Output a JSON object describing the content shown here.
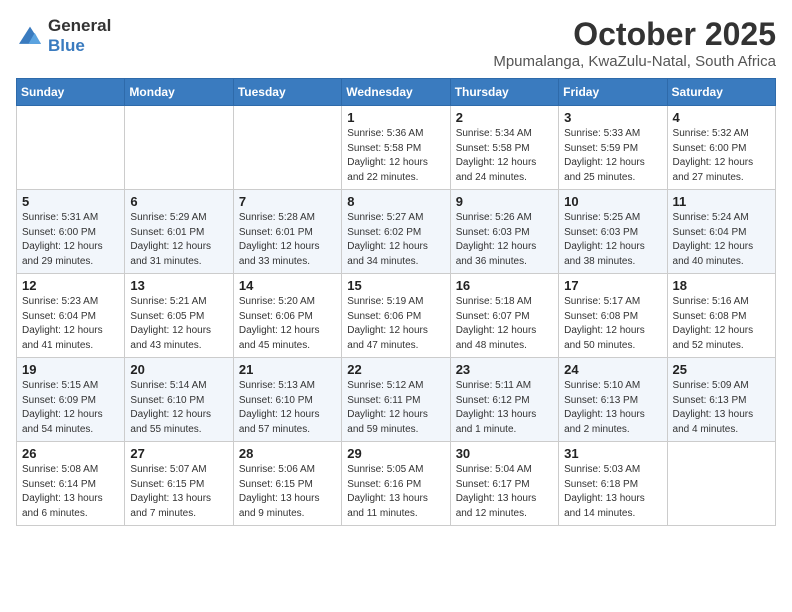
{
  "logo": {
    "general": "General",
    "blue": "Blue"
  },
  "title": "October 2025",
  "location": "Mpumalanga, KwaZulu-Natal, South Africa",
  "weekdays": [
    "Sunday",
    "Monday",
    "Tuesday",
    "Wednesday",
    "Thursday",
    "Friday",
    "Saturday"
  ],
  "weeks": [
    [
      {
        "day": "",
        "info": ""
      },
      {
        "day": "",
        "info": ""
      },
      {
        "day": "",
        "info": ""
      },
      {
        "day": "1",
        "info": "Sunrise: 5:36 AM\nSunset: 5:58 PM\nDaylight: 12 hours\nand 22 minutes."
      },
      {
        "day": "2",
        "info": "Sunrise: 5:34 AM\nSunset: 5:58 PM\nDaylight: 12 hours\nand 24 minutes."
      },
      {
        "day": "3",
        "info": "Sunrise: 5:33 AM\nSunset: 5:59 PM\nDaylight: 12 hours\nand 25 minutes."
      },
      {
        "day": "4",
        "info": "Sunrise: 5:32 AM\nSunset: 6:00 PM\nDaylight: 12 hours\nand 27 minutes."
      }
    ],
    [
      {
        "day": "5",
        "info": "Sunrise: 5:31 AM\nSunset: 6:00 PM\nDaylight: 12 hours\nand 29 minutes."
      },
      {
        "day": "6",
        "info": "Sunrise: 5:29 AM\nSunset: 6:01 PM\nDaylight: 12 hours\nand 31 minutes."
      },
      {
        "day": "7",
        "info": "Sunrise: 5:28 AM\nSunset: 6:01 PM\nDaylight: 12 hours\nand 33 minutes."
      },
      {
        "day": "8",
        "info": "Sunrise: 5:27 AM\nSunset: 6:02 PM\nDaylight: 12 hours\nand 34 minutes."
      },
      {
        "day": "9",
        "info": "Sunrise: 5:26 AM\nSunset: 6:03 PM\nDaylight: 12 hours\nand 36 minutes."
      },
      {
        "day": "10",
        "info": "Sunrise: 5:25 AM\nSunset: 6:03 PM\nDaylight: 12 hours\nand 38 minutes."
      },
      {
        "day": "11",
        "info": "Sunrise: 5:24 AM\nSunset: 6:04 PM\nDaylight: 12 hours\nand 40 minutes."
      }
    ],
    [
      {
        "day": "12",
        "info": "Sunrise: 5:23 AM\nSunset: 6:04 PM\nDaylight: 12 hours\nand 41 minutes."
      },
      {
        "day": "13",
        "info": "Sunrise: 5:21 AM\nSunset: 6:05 PM\nDaylight: 12 hours\nand 43 minutes."
      },
      {
        "day": "14",
        "info": "Sunrise: 5:20 AM\nSunset: 6:06 PM\nDaylight: 12 hours\nand 45 minutes."
      },
      {
        "day": "15",
        "info": "Sunrise: 5:19 AM\nSunset: 6:06 PM\nDaylight: 12 hours\nand 47 minutes."
      },
      {
        "day": "16",
        "info": "Sunrise: 5:18 AM\nSunset: 6:07 PM\nDaylight: 12 hours\nand 48 minutes."
      },
      {
        "day": "17",
        "info": "Sunrise: 5:17 AM\nSunset: 6:08 PM\nDaylight: 12 hours\nand 50 minutes."
      },
      {
        "day": "18",
        "info": "Sunrise: 5:16 AM\nSunset: 6:08 PM\nDaylight: 12 hours\nand 52 minutes."
      }
    ],
    [
      {
        "day": "19",
        "info": "Sunrise: 5:15 AM\nSunset: 6:09 PM\nDaylight: 12 hours\nand 54 minutes."
      },
      {
        "day": "20",
        "info": "Sunrise: 5:14 AM\nSunset: 6:10 PM\nDaylight: 12 hours\nand 55 minutes."
      },
      {
        "day": "21",
        "info": "Sunrise: 5:13 AM\nSunset: 6:10 PM\nDaylight: 12 hours\nand 57 minutes."
      },
      {
        "day": "22",
        "info": "Sunrise: 5:12 AM\nSunset: 6:11 PM\nDaylight: 12 hours\nand 59 minutes."
      },
      {
        "day": "23",
        "info": "Sunrise: 5:11 AM\nSunset: 6:12 PM\nDaylight: 13 hours\nand 1 minute."
      },
      {
        "day": "24",
        "info": "Sunrise: 5:10 AM\nSunset: 6:13 PM\nDaylight: 13 hours\nand 2 minutes."
      },
      {
        "day": "25",
        "info": "Sunrise: 5:09 AM\nSunset: 6:13 PM\nDaylight: 13 hours\nand 4 minutes."
      }
    ],
    [
      {
        "day": "26",
        "info": "Sunrise: 5:08 AM\nSunset: 6:14 PM\nDaylight: 13 hours\nand 6 minutes."
      },
      {
        "day": "27",
        "info": "Sunrise: 5:07 AM\nSunset: 6:15 PM\nDaylight: 13 hours\nand 7 minutes."
      },
      {
        "day": "28",
        "info": "Sunrise: 5:06 AM\nSunset: 6:15 PM\nDaylight: 13 hours\nand 9 minutes."
      },
      {
        "day": "29",
        "info": "Sunrise: 5:05 AM\nSunset: 6:16 PM\nDaylight: 13 hours\nand 11 minutes."
      },
      {
        "day": "30",
        "info": "Sunrise: 5:04 AM\nSunset: 6:17 PM\nDaylight: 13 hours\nand 12 minutes."
      },
      {
        "day": "31",
        "info": "Sunrise: 5:03 AM\nSunset: 6:18 PM\nDaylight: 13 hours\nand 14 minutes."
      },
      {
        "day": "",
        "info": ""
      }
    ]
  ]
}
